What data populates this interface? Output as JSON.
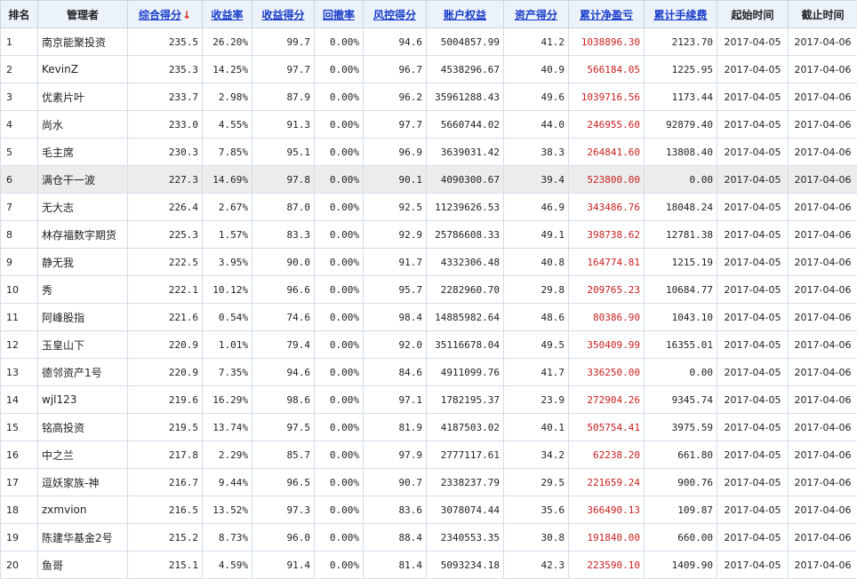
{
  "headers": [
    {
      "label": "排名",
      "link": false
    },
    {
      "label": "管理者",
      "link": false
    },
    {
      "label": "综合得分",
      "link": true,
      "sort": "↓"
    },
    {
      "label": "收益率",
      "link": true
    },
    {
      "label": "收益得分",
      "link": true
    },
    {
      "label": "回撤率",
      "link": true
    },
    {
      "label": "风控得分",
      "link": true
    },
    {
      "label": "账户权益",
      "link": true
    },
    {
      "label": "资产得分",
      "link": true
    },
    {
      "label": "累计净盈亏",
      "link": true
    },
    {
      "label": "累计手续费",
      "link": true
    },
    {
      "label": "起始时间",
      "link": false
    },
    {
      "label": "截止时间",
      "link": false
    }
  ],
  "rows": [
    [
      "1",
      "南京能聚投资",
      "235.5",
      "26.20%",
      "99.7",
      "0.00%",
      "94.6",
      "5004857.99",
      "41.2",
      "1038896.30",
      "2123.70",
      "2017-04-05",
      "2017-04-06"
    ],
    [
      "2",
      "KevinZ",
      "235.3",
      "14.25%",
      "97.7",
      "0.00%",
      "96.7",
      "4538296.67",
      "40.9",
      "566184.05",
      "1225.95",
      "2017-04-05",
      "2017-04-06"
    ],
    [
      "3",
      "优素片叶",
      "233.7",
      "2.98%",
      "87.9",
      "0.00%",
      "96.2",
      "35961288.43",
      "49.6",
      "1039716.56",
      "1173.44",
      "2017-04-05",
      "2017-04-06"
    ],
    [
      "4",
      "尚水",
      "233.0",
      "4.55%",
      "91.3",
      "0.00%",
      "97.7",
      "5660744.02",
      "44.0",
      "246955.60",
      "92879.40",
      "2017-04-05",
      "2017-04-06"
    ],
    [
      "5",
      "毛主席",
      "230.3",
      "7.85%",
      "95.1",
      "0.00%",
      "96.9",
      "3639031.42",
      "38.3",
      "264841.60",
      "13808.40",
      "2017-04-05",
      "2017-04-06"
    ],
    [
      "6",
      "满仓干一波",
      "227.3",
      "14.69%",
      "97.8",
      "0.00%",
      "90.1",
      "4090300.67",
      "39.4",
      "523800.00",
      "0.00",
      "2017-04-05",
      "2017-04-06"
    ],
    [
      "7",
      "无大志",
      "226.4",
      "2.67%",
      "87.0",
      "0.00%",
      "92.5",
      "11239626.53",
      "46.9",
      "343486.76",
      "18048.24",
      "2017-04-05",
      "2017-04-06"
    ],
    [
      "8",
      "林存福数字期货",
      "225.3",
      "1.57%",
      "83.3",
      "0.00%",
      "92.9",
      "25786608.33",
      "49.1",
      "398738.62",
      "12781.38",
      "2017-04-05",
      "2017-04-06"
    ],
    [
      "9",
      "静无我",
      "222.5",
      "3.95%",
      "90.0",
      "0.00%",
      "91.7",
      "4332306.48",
      "40.8",
      "164774.81",
      "1215.19",
      "2017-04-05",
      "2017-04-06"
    ],
    [
      "10",
      "秀",
      "222.1",
      "10.12%",
      "96.6",
      "0.00%",
      "95.7",
      "2282960.70",
      "29.8",
      "209765.23",
      "10684.77",
      "2017-04-05",
      "2017-04-06"
    ],
    [
      "11",
      "阿峰股指",
      "221.6",
      "0.54%",
      "74.6",
      "0.00%",
      "98.4",
      "14885982.64",
      "48.6",
      "80386.90",
      "1043.10",
      "2017-04-05",
      "2017-04-06"
    ],
    [
      "12",
      "玉皇山下",
      "220.9",
      "1.01%",
      "79.4",
      "0.00%",
      "92.0",
      "35116678.04",
      "49.5",
      "350409.99",
      "16355.01",
      "2017-04-05",
      "2017-04-06"
    ],
    [
      "13",
      "德邻资产1号",
      "220.9",
      "7.35%",
      "94.6",
      "0.00%",
      "84.6",
      "4911099.76",
      "41.7",
      "336250.00",
      "0.00",
      "2017-04-05",
      "2017-04-06"
    ],
    [
      "14",
      "wjl123",
      "219.6",
      "16.29%",
      "98.6",
      "0.00%",
      "97.1",
      "1782195.37",
      "23.9",
      "272904.26",
      "9345.74",
      "2017-04-05",
      "2017-04-06"
    ],
    [
      "15",
      "铭高投资",
      "219.5",
      "13.74%",
      "97.5",
      "0.00%",
      "81.9",
      "4187503.02",
      "40.1",
      "505754.41",
      "3975.59",
      "2017-04-05",
      "2017-04-06"
    ],
    [
      "16",
      "中之兰",
      "217.8",
      "2.29%",
      "85.7",
      "0.00%",
      "97.9",
      "2777117.61",
      "34.2",
      "62238.20",
      "661.80",
      "2017-04-05",
      "2017-04-06"
    ],
    [
      "17",
      "逗妖家族-神",
      "216.7",
      "9.44%",
      "96.5",
      "0.00%",
      "90.7",
      "2338237.79",
      "29.5",
      "221659.24",
      "900.76",
      "2017-04-05",
      "2017-04-06"
    ],
    [
      "18",
      "zxmvion",
      "216.5",
      "13.52%",
      "97.3",
      "0.00%",
      "83.6",
      "3078074.44",
      "35.6",
      "366490.13",
      "109.87",
      "2017-04-05",
      "2017-04-06"
    ],
    [
      "19",
      "陈建华基金2号",
      "215.2",
      "8.73%",
      "96.0",
      "0.00%",
      "88.4",
      "2340553.35",
      "30.8",
      "191840.00",
      "660.00",
      "2017-04-05",
      "2017-04-06"
    ],
    [
      "20",
      "鱼哥",
      "215.1",
      "4.59%",
      "91.4",
      "0.00%",
      "81.4",
      "5093234.18",
      "42.3",
      "223590.10",
      "1409.90",
      "2017-04-05",
      "2017-04-06"
    ]
  ],
  "highlight_row": 5,
  "colors": {
    "link": "#1a3cc9",
    "sort_arrow": "#e0281e",
    "pnl": "#c81e1e",
    "header_bg": "#ebf2fa",
    "highlight_bg": "#ececec"
  }
}
